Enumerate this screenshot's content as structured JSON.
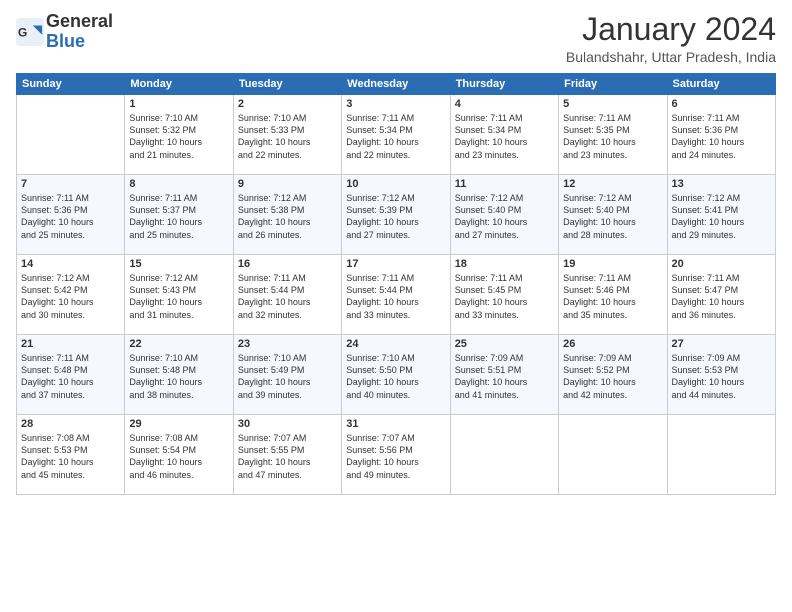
{
  "logo": {
    "general": "General",
    "blue": "Blue"
  },
  "title": "January 2024",
  "subtitle": "Bulandshahr, Uttar Pradesh, India",
  "headers": [
    "Sunday",
    "Monday",
    "Tuesday",
    "Wednesday",
    "Thursday",
    "Friday",
    "Saturday"
  ],
  "weeks": [
    [
      {
        "day": "",
        "sunrise": "",
        "sunset": "",
        "daylight": ""
      },
      {
        "day": "1",
        "sunrise": "Sunrise: 7:10 AM",
        "sunset": "Sunset: 5:32 PM",
        "daylight": "Daylight: 10 hours and 21 minutes."
      },
      {
        "day": "2",
        "sunrise": "Sunrise: 7:10 AM",
        "sunset": "Sunset: 5:33 PM",
        "daylight": "Daylight: 10 hours and 22 minutes."
      },
      {
        "day": "3",
        "sunrise": "Sunrise: 7:11 AM",
        "sunset": "Sunset: 5:34 PM",
        "daylight": "Daylight: 10 hours and 22 minutes."
      },
      {
        "day": "4",
        "sunrise": "Sunrise: 7:11 AM",
        "sunset": "Sunset: 5:34 PM",
        "daylight": "Daylight: 10 hours and 23 minutes."
      },
      {
        "day": "5",
        "sunrise": "Sunrise: 7:11 AM",
        "sunset": "Sunset: 5:35 PM",
        "daylight": "Daylight: 10 hours and 23 minutes."
      },
      {
        "day": "6",
        "sunrise": "Sunrise: 7:11 AM",
        "sunset": "Sunset: 5:36 PM",
        "daylight": "Daylight: 10 hours and 24 minutes."
      }
    ],
    [
      {
        "day": "7",
        "sunrise": "Sunrise: 7:11 AM",
        "sunset": "Sunset: 5:36 PM",
        "daylight": "Daylight: 10 hours and 25 minutes."
      },
      {
        "day": "8",
        "sunrise": "Sunrise: 7:11 AM",
        "sunset": "Sunset: 5:37 PM",
        "daylight": "Daylight: 10 hours and 25 minutes."
      },
      {
        "day": "9",
        "sunrise": "Sunrise: 7:12 AM",
        "sunset": "Sunset: 5:38 PM",
        "daylight": "Daylight: 10 hours and 26 minutes."
      },
      {
        "day": "10",
        "sunrise": "Sunrise: 7:12 AM",
        "sunset": "Sunset: 5:39 PM",
        "daylight": "Daylight: 10 hours and 27 minutes."
      },
      {
        "day": "11",
        "sunrise": "Sunrise: 7:12 AM",
        "sunset": "Sunset: 5:40 PM",
        "daylight": "Daylight: 10 hours and 27 minutes."
      },
      {
        "day": "12",
        "sunrise": "Sunrise: 7:12 AM",
        "sunset": "Sunset: 5:40 PM",
        "daylight": "Daylight: 10 hours and 28 minutes."
      },
      {
        "day": "13",
        "sunrise": "Sunrise: 7:12 AM",
        "sunset": "Sunset: 5:41 PM",
        "daylight": "Daylight: 10 hours and 29 minutes."
      }
    ],
    [
      {
        "day": "14",
        "sunrise": "Sunrise: 7:12 AM",
        "sunset": "Sunset: 5:42 PM",
        "daylight": "Daylight: 10 hours and 30 minutes."
      },
      {
        "day": "15",
        "sunrise": "Sunrise: 7:12 AM",
        "sunset": "Sunset: 5:43 PM",
        "daylight": "Daylight: 10 hours and 31 minutes."
      },
      {
        "day": "16",
        "sunrise": "Sunrise: 7:11 AM",
        "sunset": "Sunset: 5:44 PM",
        "daylight": "Daylight: 10 hours and 32 minutes."
      },
      {
        "day": "17",
        "sunrise": "Sunrise: 7:11 AM",
        "sunset": "Sunset: 5:44 PM",
        "daylight": "Daylight: 10 hours and 33 minutes."
      },
      {
        "day": "18",
        "sunrise": "Sunrise: 7:11 AM",
        "sunset": "Sunset: 5:45 PM",
        "daylight": "Daylight: 10 hours and 33 minutes."
      },
      {
        "day": "19",
        "sunrise": "Sunrise: 7:11 AM",
        "sunset": "Sunset: 5:46 PM",
        "daylight": "Daylight: 10 hours and 35 minutes."
      },
      {
        "day": "20",
        "sunrise": "Sunrise: 7:11 AM",
        "sunset": "Sunset: 5:47 PM",
        "daylight": "Daylight: 10 hours and 36 minutes."
      }
    ],
    [
      {
        "day": "21",
        "sunrise": "Sunrise: 7:11 AM",
        "sunset": "Sunset: 5:48 PM",
        "daylight": "Daylight: 10 hours and 37 minutes."
      },
      {
        "day": "22",
        "sunrise": "Sunrise: 7:10 AM",
        "sunset": "Sunset: 5:48 PM",
        "daylight": "Daylight: 10 hours and 38 minutes."
      },
      {
        "day": "23",
        "sunrise": "Sunrise: 7:10 AM",
        "sunset": "Sunset: 5:49 PM",
        "daylight": "Daylight: 10 hours and 39 minutes."
      },
      {
        "day": "24",
        "sunrise": "Sunrise: 7:10 AM",
        "sunset": "Sunset: 5:50 PM",
        "daylight": "Daylight: 10 hours and 40 minutes."
      },
      {
        "day": "25",
        "sunrise": "Sunrise: 7:09 AM",
        "sunset": "Sunset: 5:51 PM",
        "daylight": "Daylight: 10 hours and 41 minutes."
      },
      {
        "day": "26",
        "sunrise": "Sunrise: 7:09 AM",
        "sunset": "Sunset: 5:52 PM",
        "daylight": "Daylight: 10 hours and 42 minutes."
      },
      {
        "day": "27",
        "sunrise": "Sunrise: 7:09 AM",
        "sunset": "Sunset: 5:53 PM",
        "daylight": "Daylight: 10 hours and 44 minutes."
      }
    ],
    [
      {
        "day": "28",
        "sunrise": "Sunrise: 7:08 AM",
        "sunset": "Sunset: 5:53 PM",
        "daylight": "Daylight: 10 hours and 45 minutes."
      },
      {
        "day": "29",
        "sunrise": "Sunrise: 7:08 AM",
        "sunset": "Sunset: 5:54 PM",
        "daylight": "Daylight: 10 hours and 46 minutes."
      },
      {
        "day": "30",
        "sunrise": "Sunrise: 7:07 AM",
        "sunset": "Sunset: 5:55 PM",
        "daylight": "Daylight: 10 hours and 47 minutes."
      },
      {
        "day": "31",
        "sunrise": "Sunrise: 7:07 AM",
        "sunset": "Sunset: 5:56 PM",
        "daylight": "Daylight: 10 hours and 49 minutes."
      },
      {
        "day": "",
        "sunrise": "",
        "sunset": "",
        "daylight": ""
      },
      {
        "day": "",
        "sunrise": "",
        "sunset": "",
        "daylight": ""
      },
      {
        "day": "",
        "sunrise": "",
        "sunset": "",
        "daylight": ""
      }
    ]
  ]
}
